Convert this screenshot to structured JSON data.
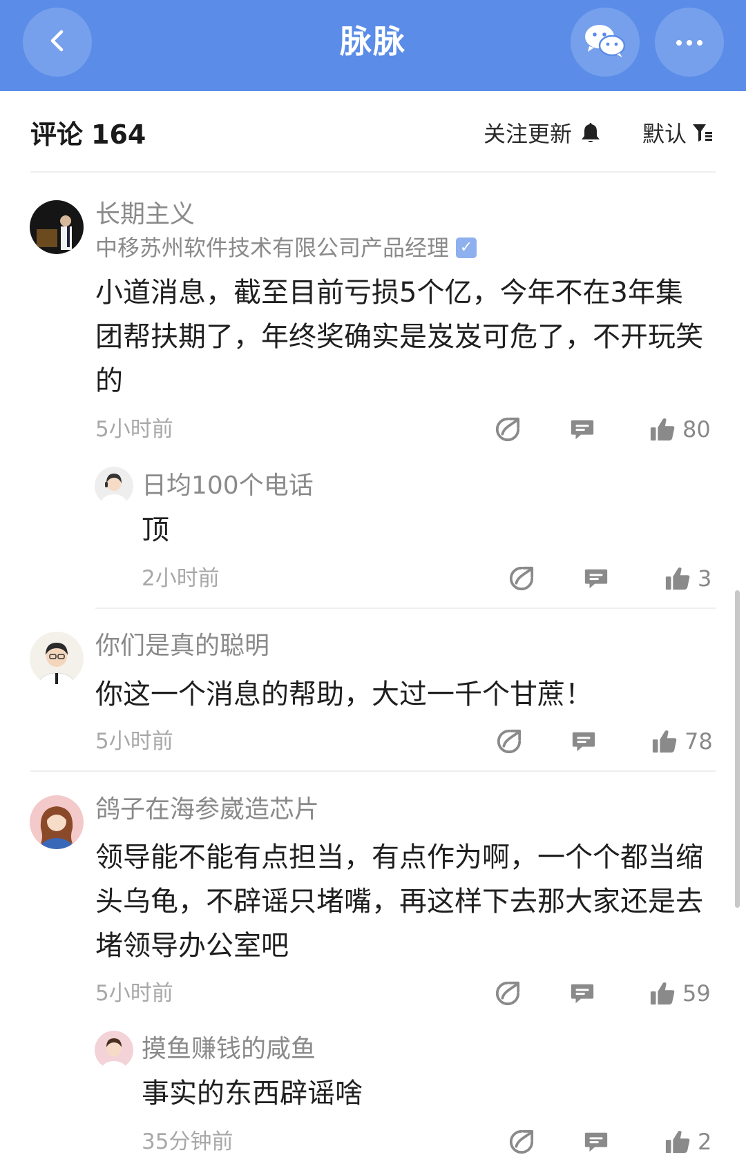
{
  "app": {
    "title": "脉脉"
  },
  "comments_header": {
    "title": "评论",
    "count": "164",
    "follow_label": "关注更新",
    "sort_label": "默认"
  },
  "comments": [
    {
      "username": "长期主义",
      "subtitle": "中移苏州软件技术有限公司产品经理",
      "verified": true,
      "content": "小道消息，截至目前亏损5个亿，今年不在3年集团帮扶期了，年终奖确实是岌岌可危了，不开玩笑的",
      "time": "5小时前",
      "likes": "80",
      "replies": [
        {
          "username": "日均100个电话",
          "content": "顶",
          "time": "2小时前",
          "likes": "3"
        }
      ]
    },
    {
      "username": "你们是真的聪明",
      "content": "你这一个消息的帮助，大过一千个甘蔗！",
      "time": "5小时前",
      "likes": "78"
    },
    {
      "username": "鸽子在海参崴造芯片",
      "content": "领导能不能有点担当，有点作为啊，一个个都当缩头乌龟，不辟谣只堵嘴，再这样下去那大家还是去堵领导办公室吧",
      "time": "5小时前",
      "likes": "59",
      "replies": [
        {
          "username": "摸鱼赚钱的咸鱼",
          "content": "事实的东西辟谣啥",
          "time": "35分钟前",
          "likes": "2"
        }
      ]
    }
  ],
  "colors": {
    "brand": "#5a8ce8",
    "icon_gray": "#8a8a8a",
    "verify_badge": "#8eb0ee"
  },
  "icons": {
    "back": "chevron-left-icon",
    "wechat": "wechat-icon",
    "more": "more-dots-icon",
    "bell": "bell-icon",
    "filter": "filter-icon",
    "share": "share-icon",
    "reply": "comment-icon",
    "like": "thumbs-up-icon"
  }
}
